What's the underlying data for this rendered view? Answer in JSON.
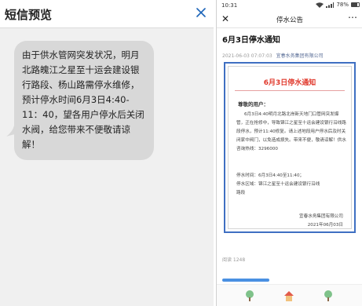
{
  "sms": {
    "title": "短信预览",
    "message": "由于供水管网突发状况，明月北路魄江之星至十运会建设银行路段、杨山路需停水维修，预计停水时间6月3日4:40-11：40，望各用户停水后关闭水阀，给您带来不便敬请谅解！"
  },
  "phone": {
    "status": {
      "time": "10:31",
      "battery": "78%",
      "battery_level": 0.78
    },
    "nav": {
      "title": "停水公告"
    },
    "article": {
      "title": "6月3日停水通知",
      "date": "2021-06-03 07:07:03",
      "source": "宜春水务集团有限公司"
    },
    "notice": {
      "title": "6月3日停水通知",
      "salutation": "尊敬的用户：",
      "body": "6月3日4:40明月北路北岸新天地门口管网突发爆管，正在抢修中，导致锦江之星至十运会建设银行沿线路段停水，预计11:40修复。请上述地段用户停水后及时关闭家中阀门，以免造成损失。带来不便，敬请谅解！供水咨询热线：3296000",
      "time_line": "停水时间：6月3日4:40至11:40；",
      "area_line_1": "停水区域：锦江之星至十运会建设银行沿线",
      "area_line_2": "路段",
      "org": "宜春水务集团有限公司",
      "date": "2021年06月03日"
    },
    "reads": "阅读 1248"
  },
  "colors": {
    "notice_border": "#3f6fc2",
    "notice_title": "#e0382b",
    "close_icon": "#1a63b8",
    "source_link": "#576b95"
  }
}
